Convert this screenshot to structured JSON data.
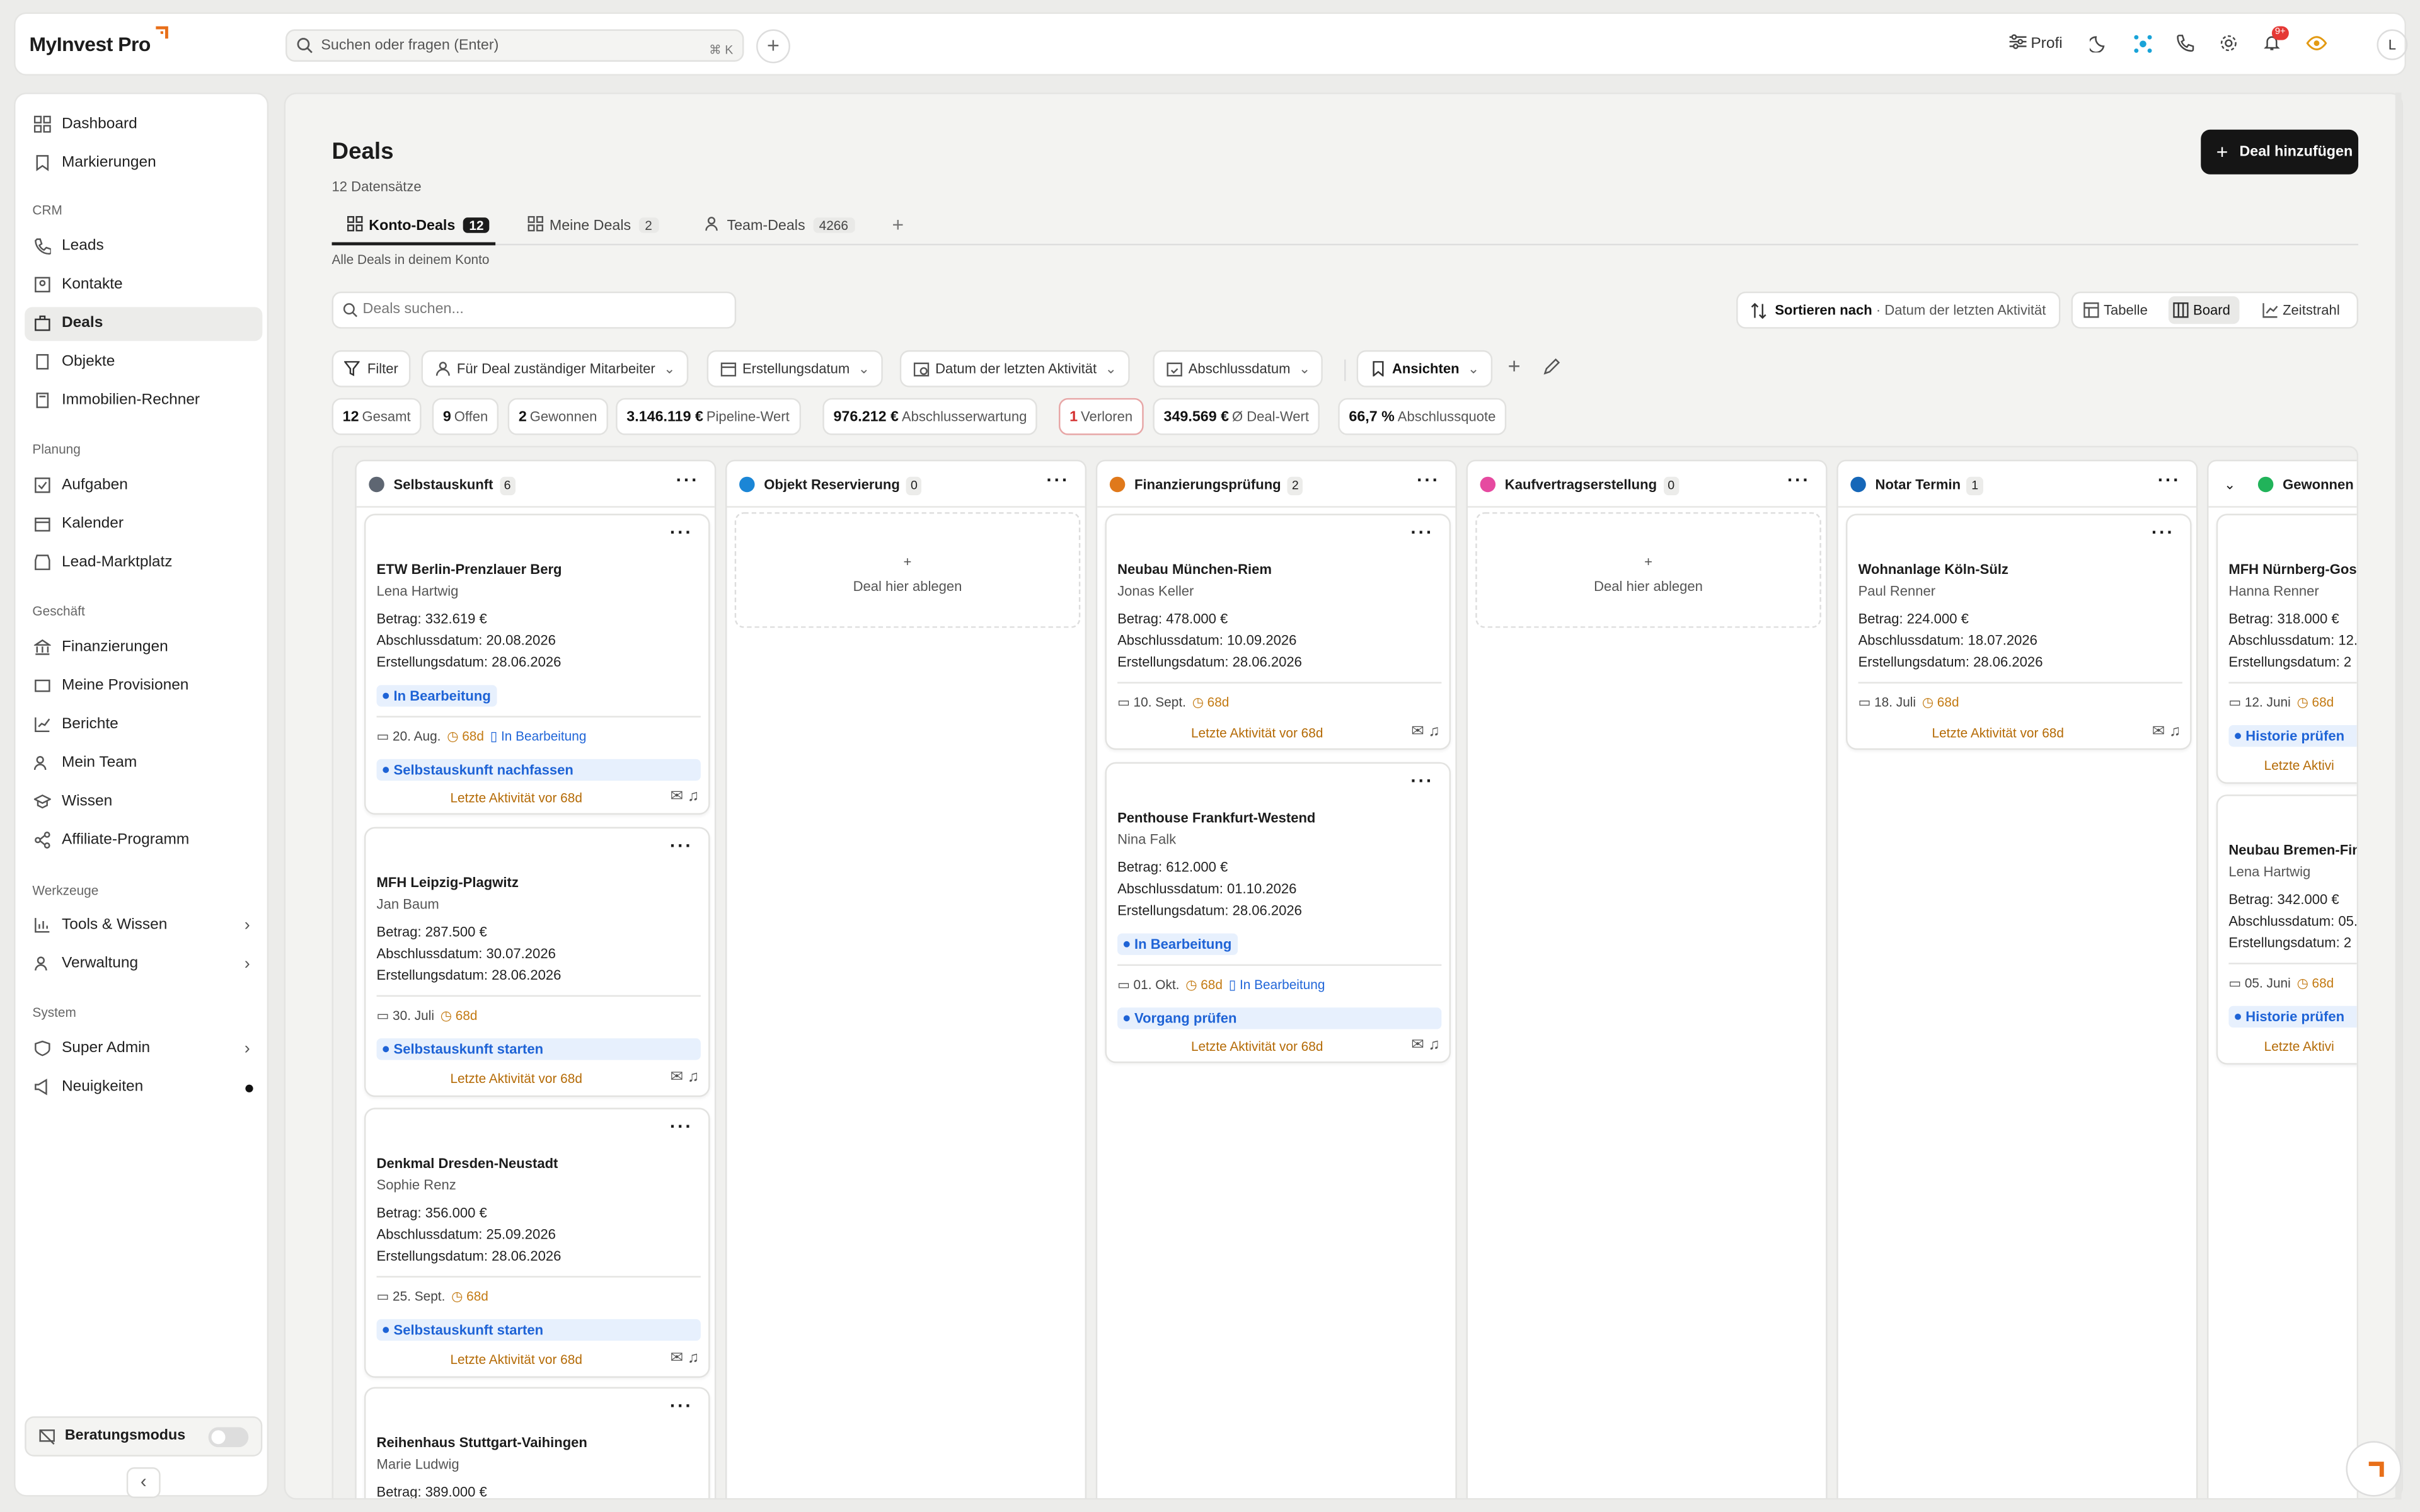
{
  "app": {
    "logo": "MyInvest Pro",
    "search_placeholder": "Suchen oder fragen (Enter)",
    "search_kbd": "⌘ K",
    "profile": "Profi",
    "notif_badge": "9+",
    "avatar": "L"
  },
  "sidebar": {
    "top": [
      {
        "label": "Dashboard"
      },
      {
        "label": "Markierungen"
      }
    ],
    "crm_title": "CRM",
    "crm": [
      {
        "label": "Leads"
      },
      {
        "label": "Kontakte"
      },
      {
        "label": "Deals"
      },
      {
        "label": "Objekte"
      },
      {
        "label": "Immobilien-Rechner"
      }
    ],
    "planung_title": "Planung",
    "planung": [
      {
        "label": "Aufgaben"
      },
      {
        "label": "Kalender"
      },
      {
        "label": "Lead-Marktplatz"
      }
    ],
    "geschaeft_title": "Geschäft",
    "geschaeft": [
      {
        "label": "Finanzierungen"
      },
      {
        "label": "Meine Provisionen"
      },
      {
        "label": "Berichte"
      },
      {
        "label": "Mein Team"
      },
      {
        "label": "Wissen"
      },
      {
        "label": "Affiliate-Programm"
      }
    ],
    "werkzeuge_title": "Werkzeuge",
    "werkzeuge": [
      {
        "label": "Tools & Wissen"
      },
      {
        "label": "Verwaltung"
      }
    ],
    "system_title": "System",
    "system": [
      {
        "label": "Super Admin"
      },
      {
        "label": "Neuigkeiten"
      }
    ],
    "beratungsmodus": "Beratungsmodus"
  },
  "page": {
    "title": "Deals",
    "subtitle": "12 Datensätze",
    "add_button": "Deal hinzufügen",
    "tabs": [
      {
        "label": "Konto-Deals",
        "count": "12"
      },
      {
        "label": "Meine Deals",
        "count": "2"
      },
      {
        "label": "Team-Deals",
        "count": "4266"
      }
    ],
    "tab_note": "Alle Deals in deinem Konto",
    "search_placeholder": "Deals suchen...",
    "sort_label": "Sortieren nach",
    "sort_value": "· Datum der letzten Aktivität",
    "views": [
      "Tabelle",
      "Board",
      "Zeitstrahl"
    ],
    "filters": [
      "Filter",
      "Für Deal zuständiger Mitarbeiter",
      "Erstellungsdatum",
      "Datum der letzten Aktivität",
      "Abschlussdatum",
      "Ansichten"
    ],
    "stats": [
      {
        "v": "12",
        "l": "Gesamt"
      },
      {
        "v": "9",
        "l": "Offen"
      },
      {
        "v": "2",
        "l": "Gewonnen"
      },
      {
        "v": "3.146.119 €",
        "l": "Pipeline-Wert"
      },
      {
        "v": "976.212 €",
        "l": "Abschlusserwartung"
      },
      {
        "v": "1",
        "l": "Verloren"
      },
      {
        "v": "349.569 €",
        "l": "Ø Deal-Wert"
      },
      {
        "v": "66,7 %",
        "l": "Abschlussquote"
      }
    ]
  },
  "board": {
    "drop_text": "Deal hier ablegen",
    "plus": "+",
    "last_activity": "Letzte Aktivität vor 68d",
    "age": "68d",
    "columns": [
      {
        "name": "Selbstauskunft",
        "count": "6",
        "color": "#5e6672"
      },
      {
        "name": "Objekt Reservierung",
        "count": "0",
        "color": "#1b86d6"
      },
      {
        "name": "Finanzierungsprüfung",
        "count": "2",
        "color": "#e0791b"
      },
      {
        "name": "Kaufvertragserstellung",
        "count": "0",
        "color": "#e64aa0"
      },
      {
        "name": "Notar Termin",
        "count": "1",
        "color": "#1667b8"
      },
      {
        "name": "Gewonnen",
        "count": "",
        "color": "#21b35a"
      }
    ],
    "cards": [
      {
        "title": "ETW Berlin-Prenzlauer Berg",
        "person": "Lena Hartwig",
        "betrag": "Betrag: 332.619 €",
        "abschluss": "Abschlussdatum: 20.08.2026",
        "erstellung": "Erstellungsdatum: 28.06.2026",
        "status": "In Bearbeitung",
        "date": "20. Aug.",
        "task": "Selbstauskunft nachfassen"
      },
      {
        "title": "MFH Leipzig-Plagwitz",
        "person": "Jan Baum",
        "betrag": "Betrag: 287.500 €",
        "abschluss": "Abschlussdatum: 30.07.2026",
        "erstellung": "Erstellungsdatum: 28.06.2026",
        "date": "30. Juli",
        "task": "Selbstauskunft starten"
      },
      {
        "title": "Denkmal Dresden-Neustadt",
        "person": "Sophie Renz",
        "betrag": "Betrag: 356.000 €",
        "abschluss": "Abschlussdatum: 25.09.2026",
        "erstellung": "Erstellungsdatum: 28.06.2026",
        "date": "25. Sept.",
        "task": "Selbstauskunft starten"
      },
      {
        "title": "Reihenhaus Stuttgart-Vaihingen",
        "person": "Marie Ludwig",
        "betrag": "Betrag: 389.000 €"
      },
      {
        "title": "Neubau München-Riem",
        "person": "Jonas Keller",
        "betrag": "Betrag: 478.000 €",
        "abschluss": "Abschlussdatum: 10.09.2026",
        "erstellung": "Erstellungsdatum: 28.06.2026",
        "date": "10. Sept."
      },
      {
        "title": "Penthouse Frankfurt-Westend",
        "person": "Nina Falk",
        "betrag": "Betrag: 612.000 €",
        "abschluss": "Abschlussdatum: 01.10.2026",
        "erstellung": "Erstellungsdatum: 28.06.2026",
        "status": "In Bearbeitung",
        "date": "01. Okt.",
        "task": "Vorgang prüfen"
      },
      {
        "title": "Wohnanlage Köln-Sülz",
        "person": "Paul Renner",
        "betrag": "Betrag: 224.000 €",
        "abschluss": "Abschlussdatum: 18.07.2026",
        "erstellung": "Erstellungsdatum: 28.06.2026",
        "date": "18. Juli"
      },
      {
        "title": "MFH Nürnberg-Gostenhof",
        "person": "Hanna Renner",
        "betrag": "Betrag: 318.000 €",
        "abschluss": "Abschlussdatum: 12.",
        "erstellung": "Erstellungsdatum: 2",
        "date": "12. Juni",
        "task": "Historie prüfen",
        "last": "Letzte Aktivi"
      },
      {
        "title": "Neubau Bremen-Findorff",
        "person": "Lena Hartwig",
        "betrag": "Betrag: 342.000 €",
        "abschluss": "Abschlussdatum: 05.",
        "erstellung": "Erstellungsdatum: 2",
        "date": "05. Juni",
        "task": "Historie prüfen",
        "last": "Letzte Aktivi"
      }
    ]
  }
}
